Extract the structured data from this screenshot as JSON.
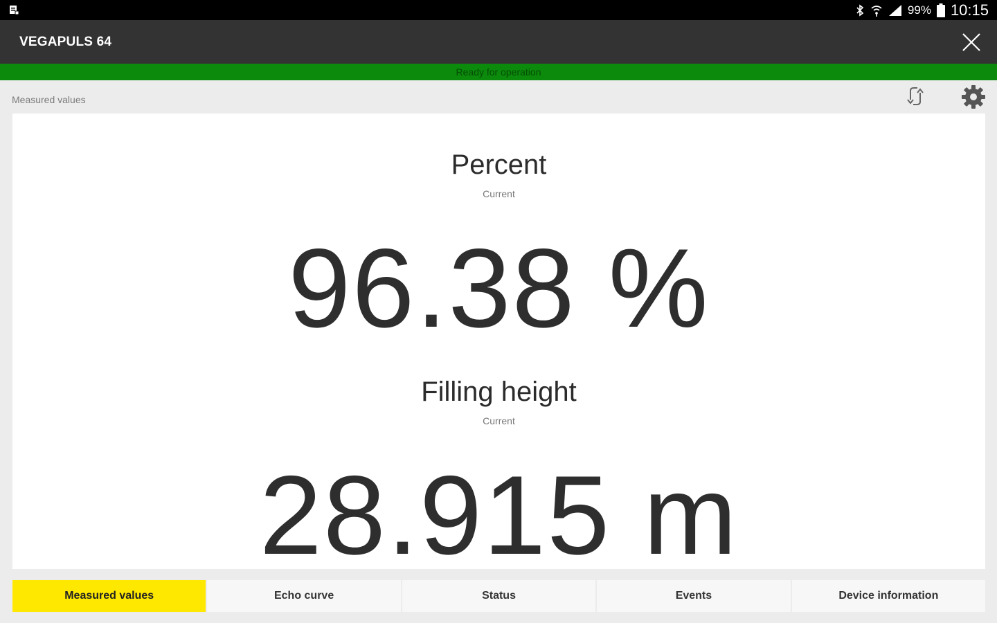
{
  "status_bar": {
    "battery": "99%",
    "time": "10:15",
    "icons": [
      "notification-icon",
      "bluetooth-icon",
      "wifi-icon",
      "signal-icon",
      "battery-icon"
    ]
  },
  "app_bar": {
    "title": "VEGAPULS 64",
    "close_icon": "close-icon"
  },
  "status_banner": {
    "text": "Ready for operation",
    "color": "#0b8a0b"
  },
  "toolbar": {
    "section_label": "Measured values",
    "refresh_icon": "refresh-icon",
    "settings_icon": "gear-icon"
  },
  "measurements": [
    {
      "title": "Percent",
      "subtitle": "Current",
      "value": "96.38 %"
    },
    {
      "title": "Filling height",
      "subtitle": "Current",
      "value": "28.915 m"
    }
  ],
  "tabs": [
    {
      "label": "Measured values",
      "active": true
    },
    {
      "label": "Echo curve",
      "active": false
    },
    {
      "label": "Status",
      "active": false
    },
    {
      "label": "Events",
      "active": false
    },
    {
      "label": "Device information",
      "active": false
    }
  ],
  "colors": {
    "accent": "#ffe800",
    "app_bar": "#333333",
    "status_ok": "#0b8a0b"
  }
}
